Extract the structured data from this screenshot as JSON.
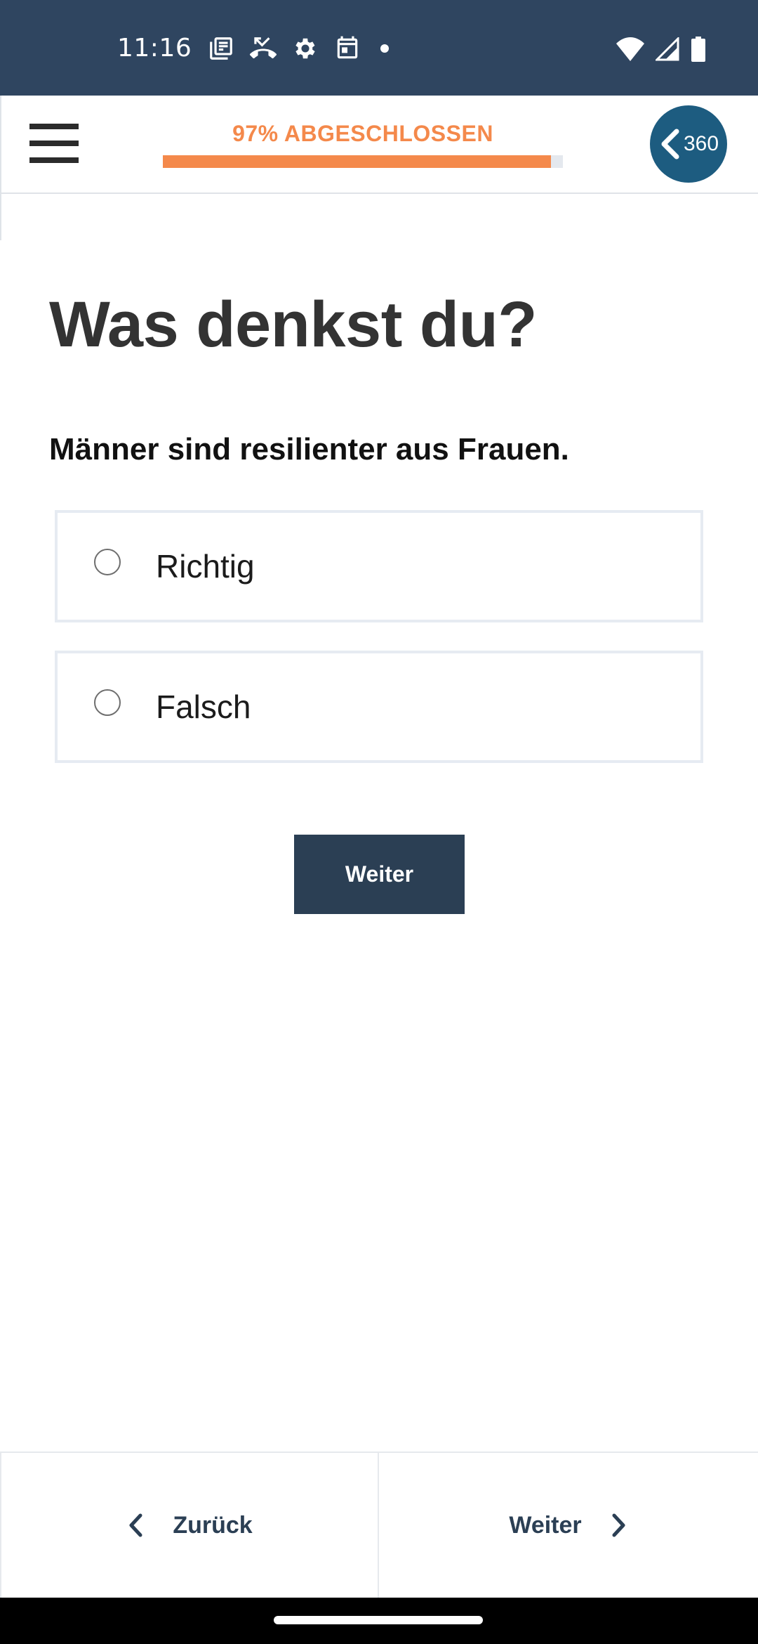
{
  "status_bar": {
    "time": "11:16",
    "left_icons": [
      "news-icon",
      "missed-call-icon",
      "settings-gear-icon",
      "calendar-icon",
      "notification-dot"
    ],
    "right_icons": [
      "wifi-icon",
      "cell-signal-icon",
      "battery-icon"
    ]
  },
  "header": {
    "menu_icon": "hamburger-menu-icon",
    "progress": {
      "label": "97% ABGESCHLOSSEN",
      "percent": 97
    },
    "badge": {
      "icon": "chevron-left-icon",
      "text": "360"
    },
    "colors": {
      "accent": "#f4894b",
      "badge": "#1d5c80",
      "statusbar": "#2f4560"
    }
  },
  "content": {
    "title": "Was denkst du?",
    "question": "Männer sind resilienter aus Frauen.",
    "options": [
      {
        "label": "Richtig",
        "selected": false
      },
      {
        "label": "Falsch",
        "selected": false
      }
    ],
    "submit_label": "Weiter"
  },
  "bottom_nav": {
    "back_label": "Zurück",
    "next_label": "Weiter"
  }
}
